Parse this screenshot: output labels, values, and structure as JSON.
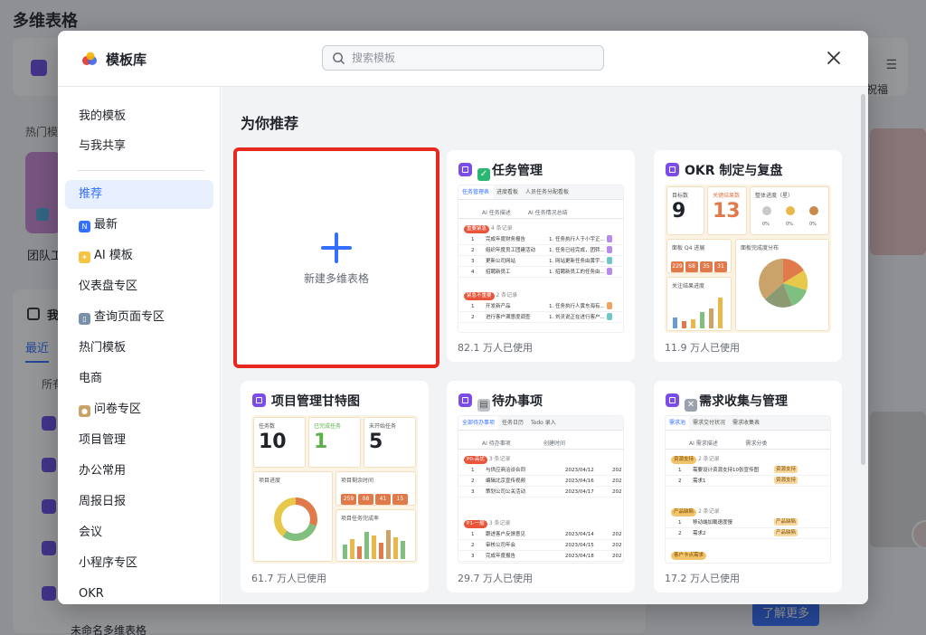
{
  "background": {
    "page_title": "多维表格",
    "hot_label": "热门模",
    "team_label": "团队工",
    "section_title": "我",
    "recent_tab": "最近",
    "all_label": "所有",
    "right_text": "祝福",
    "bottom_row_name": "未命名多维表格",
    "learn_more": "了解更多"
  },
  "modal": {
    "title": "模板库",
    "search_placeholder": "搜索模板",
    "close_label": "✕"
  },
  "sidebar": {
    "items": [
      {
        "label": "我的模板",
        "icon": ""
      },
      {
        "label": "与我共享",
        "icon": ""
      },
      {
        "label": "推荐",
        "icon": "",
        "active": true
      },
      {
        "label": "最新",
        "icon": "new-badge-icon"
      },
      {
        "label": "AI 模板",
        "icon": "sparkle-icon"
      },
      {
        "label": "仪表盘专区",
        "icon": ""
      },
      {
        "label": "查询页面专区",
        "icon": "book-icon"
      },
      {
        "label": "热门模板",
        "icon": ""
      },
      {
        "label": "电商",
        "icon": ""
      },
      {
        "label": "问卷专区",
        "icon": "person-desk-icon"
      },
      {
        "label": "项目管理",
        "icon": ""
      },
      {
        "label": "办公常用",
        "icon": ""
      },
      {
        "label": "周报日报",
        "icon": ""
      },
      {
        "label": "会议",
        "icon": ""
      },
      {
        "label": "小程序专区",
        "icon": ""
      },
      {
        "label": "OKR",
        "icon": ""
      }
    ]
  },
  "main": {
    "section_title": "为你推荐",
    "new_card_label": "新建多维表格",
    "templates": [
      {
        "title": "任务管理",
        "emoji": "check-box-icon",
        "usage": "82.1 万人已使用"
      },
      {
        "title": "OKR 制定与复盘",
        "emoji": "",
        "usage": "11.9 万人已使用"
      },
      {
        "title": "项目管理甘特图",
        "emoji": "",
        "usage": "61.7 万人已使用"
      },
      {
        "title": "待办事项",
        "emoji": "notepad-icon",
        "usage": "29.7 万人已使用"
      },
      {
        "title": "需求收集与管理",
        "emoji": "tools-icon",
        "usage": "17.2 万人已使用"
      }
    ]
  },
  "previews": {
    "task": {
      "tabs": [
        "任务管理表",
        "进度看板",
        "人员任务分配看板"
      ],
      "head": [
        "AI 任务描述",
        "AI 任务情况总结"
      ],
      "groups": [
        {
          "tag": "重要紧急",
          "count": "4 条记录",
          "color": "#e8553a"
        },
        {
          "tag": "紧急不重要",
          "count": "2 条记录",
          "color": "#e8553a"
        }
      ],
      "rows": [
        [
          "1",
          "完成年度财务报告",
          "1. 任务执行人于小宇正..."
        ],
        [
          "2",
          "组织年度员工团建活动",
          "1. 任务已经完成，团转..."
        ],
        [
          "3",
          "更新公司网站",
          "1. 网站更新任务由黄宇..."
        ],
        [
          "4",
          "招聘新员工",
          "1. 招聘新员工的任务由..."
        ],
        [
          "1",
          "开发新产品",
          "1. 任务执行人黄东海有..."
        ],
        [
          "2",
          "进行客户满意度调查",
          "1. 刘灵说正在进行客户..."
        ]
      ]
    },
    "okr": {
      "stat1_label": "目标数",
      "stat1_value": "9",
      "stat2_label": "关键结果数",
      "stat2_value": "13",
      "progress_label": "整体进度（星）",
      "progress_values": [
        "0%",
        "0%",
        "0%"
      ],
      "q4_label": "面板 Q4 进展",
      "q4_values": [
        "229",
        "68",
        "35",
        "31"
      ],
      "pie_label": "面板完成度分布",
      "bar_label": "关注结果进度"
    },
    "gantt": {
      "stat1_label": "任务数",
      "stat1_value": "10",
      "stat2_label": "已完成任务",
      "stat2_value": "1",
      "stat3_label": "未开始任务",
      "stat3_value": "5",
      "ring_label": "项目进度",
      "mini_label": "项目剩余时间",
      "mini_values": [
        "259",
        "08",
        "41",
        "15"
      ],
      "bar_label": "项目任务完成率"
    },
    "todo": {
      "tabs": [
        "全部待办事项",
        "任务日历",
        "Todo 录入"
      ],
      "head": [
        "AI 待办事项",
        "创建时间"
      ],
      "groups": [
        {
          "tag": "P0-高优",
          "count": "3 条记录",
          "color": "#e8553a"
        },
        {
          "tag": "P1-一般",
          "count": "3 条记录",
          "color": "#e8553a"
        }
      ],
      "rows": [
        [
          "1",
          "与供应商洽谈合同",
          "2023/04/12",
          "202"
        ],
        [
          "2",
          "编辑北京宣传视频",
          "2023/04/16",
          "202"
        ],
        [
          "3",
          "策划公司公关活动",
          "2023/04/17",
          "202"
        ],
        [
          "1",
          "跟进客户反馈意见",
          "2023/04/14",
          "202"
        ],
        [
          "2",
          "审核公司年会",
          "2023/04/15",
          "202"
        ],
        [
          "3",
          "完成年度报告",
          "2023/04/18",
          "202"
        ]
      ]
    },
    "req": {
      "tabs": [
        "需求池",
        "需求交付状况",
        "需求收集表"
      ],
      "head": [
        "AI 需求描述",
        "需求分类"
      ],
      "groups": [
        {
          "tag": "资源支持",
          "count": "2 条记录",
          "color": "#f2c46b"
        },
        {
          "tag": "产品缺陷",
          "count": "2 条记录",
          "color": "#f2c46b"
        },
        {
          "tag": "客户卡点需求",
          "count": "",
          "color": "#f2c46b"
        }
      ],
      "rows": [
        [
          "1",
          "需要设计资源支持10张宣传图",
          "资源支持"
        ],
        [
          "2",
          "需求1",
          "资源支持"
        ],
        [
          "1",
          "移动端加载速度慢",
          "产品缺陷"
        ],
        [
          "2",
          "需求2",
          "产品缺陷"
        ]
      ]
    }
  },
  "colors": {
    "accent": "#3370ff",
    "highlight_border": "#e8291f",
    "template_icon": "#7b4de6"
  }
}
